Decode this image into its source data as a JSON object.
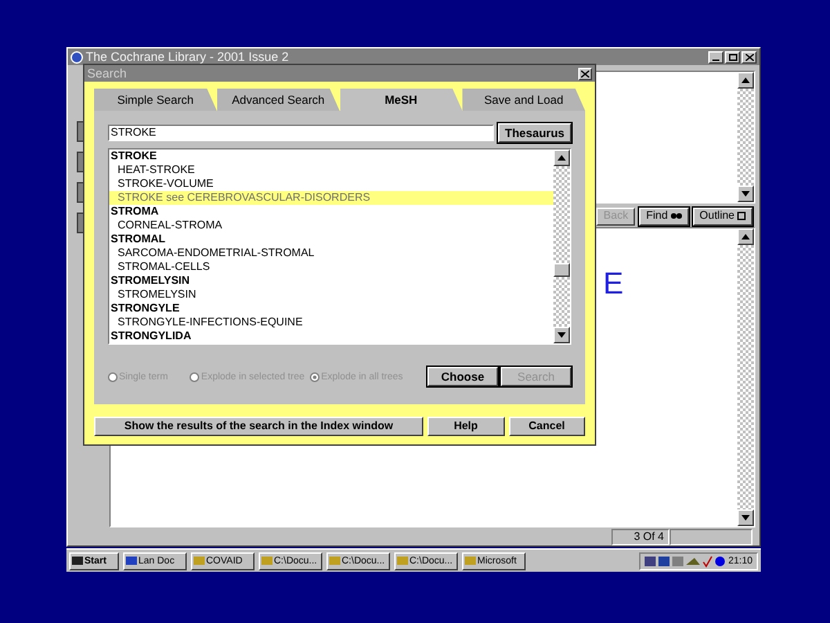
{
  "main_window": {
    "title": "The Cochrane Library - 2001 Issue 2",
    "toolbar": [
      {
        "label": "Back",
        "disabled": true
      },
      {
        "label": "Find",
        "disabled": false
      },
      {
        "label": "Outline",
        "disabled": false
      }
    ],
    "heading_fragment": "E",
    "status_bar": "3 Of 4"
  },
  "search_dialog": {
    "title": "Search",
    "tabs": [
      {
        "label": "Simple Search",
        "selected": false
      },
      {
        "label": "Advanced Search",
        "selected": false
      },
      {
        "label": "MeSH",
        "selected": true
      },
      {
        "label": "Save and Load",
        "selected": false
      }
    ],
    "query": "STROKE",
    "thesaurus_button": "Thesaurus",
    "terms": [
      {
        "label": "STROKE",
        "kind": "heading",
        "selected": false
      },
      {
        "label": "HEAT-STROKE",
        "kind": "term",
        "selected": false
      },
      {
        "label": "STROKE-VOLUME",
        "kind": "term",
        "selected": false
      },
      {
        "label": "STROKE see CEREBROVASCULAR-DISORDERS",
        "kind": "term",
        "selected": true
      },
      {
        "label": "STROMA",
        "kind": "heading",
        "selected": false
      },
      {
        "label": "CORNEAL-STROMA",
        "kind": "term",
        "selected": false
      },
      {
        "label": "STROMAL",
        "kind": "heading",
        "selected": false
      },
      {
        "label": "SARCOMA-ENDOMETRIAL-STROMAL",
        "kind": "term",
        "selected": false
      },
      {
        "label": "STROMAL-CELLS",
        "kind": "term",
        "selected": false
      },
      {
        "label": "STROMELYSIN",
        "kind": "heading",
        "selected": false
      },
      {
        "label": "STROMELYSIN",
        "kind": "term",
        "selected": false
      },
      {
        "label": "STRONGYLE",
        "kind": "heading",
        "selected": false
      },
      {
        "label": "STRONGYLE-INFECTIONS-EQUINE",
        "kind": "term",
        "selected": false
      },
      {
        "label": "STRONGYLIDA",
        "kind": "heading",
        "selected": false
      }
    ],
    "options": [
      {
        "label": "Single term",
        "selected": false
      },
      {
        "label": "Explode in selected tree",
        "selected": false
      },
      {
        "label": "Explode in all trees",
        "selected": true
      }
    ],
    "buttons": [
      {
        "label": "Choose",
        "disabled": false
      },
      {
        "label": "Search",
        "disabled": true
      }
    ],
    "footer_buttons": [
      "Show the results of the search in the Index window",
      "Help",
      "Cancel"
    ]
  },
  "taskbar": {
    "items": [
      "Start",
      "Lan Doc",
      "COVAID",
      "C:\\Docu...",
      "C:\\Docu...",
      "C:\\Docu...",
      "Microsoft"
    ],
    "clock": "21:10"
  }
}
